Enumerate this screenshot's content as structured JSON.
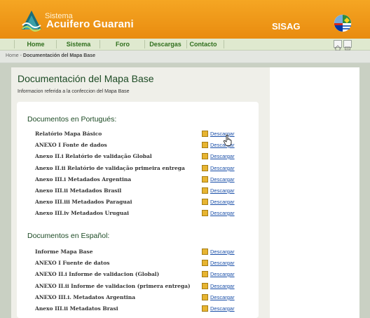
{
  "header": {
    "brand_small": "Sistema",
    "brand_big": "Acuifero Guarani",
    "product": "SISAG",
    "logo_icon": "aquifer-logo-icon",
    "flags_icon": "mercosur-flags-icon",
    "colors": {
      "bar": "#f0a01c",
      "nav": "#dfe9cf",
      "link": "#1a4fa8",
      "title": "#1d4b25"
    }
  },
  "nav": {
    "items": [
      {
        "label": "Home"
      },
      {
        "label": "Sistema"
      },
      {
        "label": "Foro"
      },
      {
        "label": "Descargas"
      },
      {
        "label": "Contacto"
      }
    ],
    "icons": [
      "home-icon",
      "print-icon"
    ]
  },
  "breadcrumb": {
    "home": "Home",
    "separator": " - ",
    "current": "Documentación del Mapa Base"
  },
  "main": {
    "title": "Documentación del Mapa Base",
    "subtitle": "Informacion referida a la confeccion del Mapa Base",
    "sections": [
      {
        "title": "Documentos en Portugués:",
        "items": [
          {
            "label": "Relatório Mapa Básico",
            "link": "Descargar"
          },
          {
            "label": "ANEXO I Fonte de dados",
            "link": "Descargar"
          },
          {
            "label": "Anexo II.i Relatório de validação Global",
            "link": "Descargar"
          },
          {
            "label": "Anexo II.ii Relatório de validação primeira entrega",
            "link": "Descargar"
          },
          {
            "label": "Anexo III.i Metadados Argentina",
            "link": "Descargar"
          },
          {
            "label": "Anexo III.ii Metadados Brasil",
            "link": "Descargar"
          },
          {
            "label": "Anexo III.iii Metadados Paraguai",
            "link": "Descargar"
          },
          {
            "label": "Anexo III.iv Metadados Uruguai",
            "link": "Descargar"
          }
        ]
      },
      {
        "title": "Documentos en Español:",
        "items": [
          {
            "label": "Informe Mapa Base",
            "link": "Descargar"
          },
          {
            "label": "ANEXO I Fuente de datos",
            "link": "Descargar"
          },
          {
            "label": "ANEXO II.i Informe de validacion (Global)",
            "link": "Descargar"
          },
          {
            "label": "ANEXO II.ii Informe de validacion (primera entrega)",
            "link": "Descargar"
          },
          {
            "label": "ANEXO III.i. Metadatos Argentina",
            "link": "Descargar"
          },
          {
            "label": "Anexo III.ii Metadatos Brasi",
            "link": "Descargar"
          }
        ]
      }
    ]
  }
}
